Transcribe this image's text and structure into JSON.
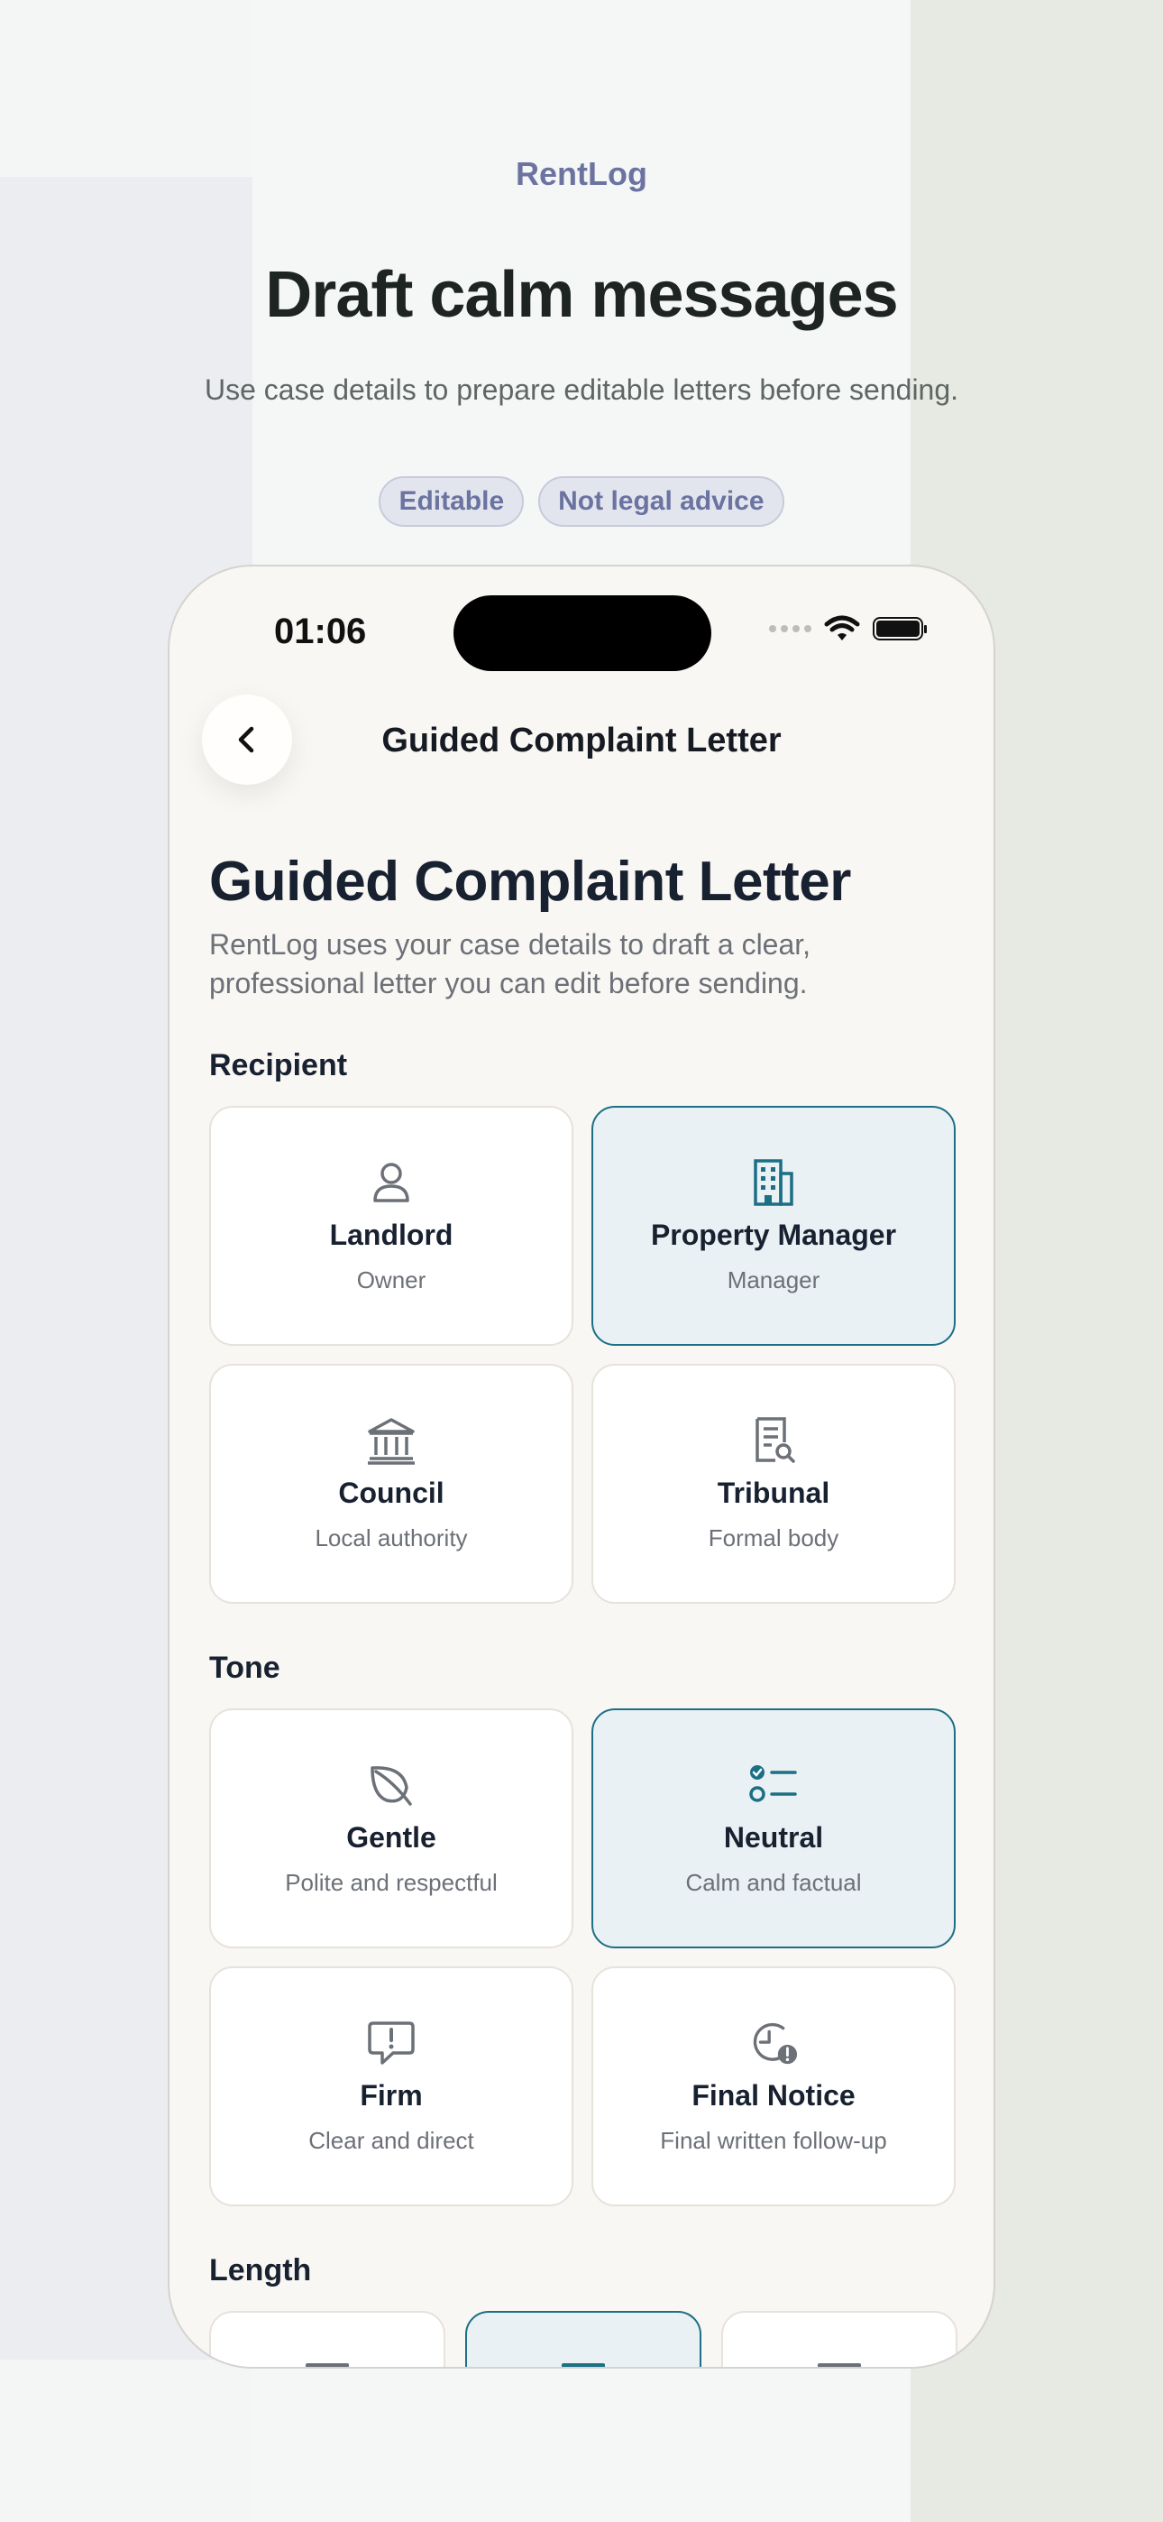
{
  "brand": "RentLog",
  "hero": {
    "title": "Draft calm messages",
    "subtitle": "Use case details to prepare editable letters before sending.",
    "chips": [
      "Editable",
      "Not legal advice"
    ]
  },
  "status_bar": {
    "time": "01:06"
  },
  "nav": {
    "title": "Guided Complaint Letter",
    "back_icon": "chevron-left-icon"
  },
  "page": {
    "title": "Guided Complaint Letter",
    "description": "RentLog uses your case details to draft a clear, professional letter you can edit before sending."
  },
  "recipient": {
    "label": "Recipient",
    "options": [
      {
        "title": "Landlord",
        "subtitle": "Owner",
        "icon": "person-icon",
        "selected": false
      },
      {
        "title": "Property Manager",
        "subtitle": "Manager",
        "icon": "building-icon",
        "selected": true
      },
      {
        "title": "Council",
        "subtitle": "Local authority",
        "icon": "government-building-icon",
        "selected": false
      },
      {
        "title": "Tribunal",
        "subtitle": "Formal body",
        "icon": "document-search-icon",
        "selected": false
      }
    ]
  },
  "tone": {
    "label": "Tone",
    "options": [
      {
        "title": "Gentle",
        "subtitle": "Polite and respectful",
        "icon": "leaf-icon",
        "selected": false
      },
      {
        "title": "Neutral",
        "subtitle": "Calm and factual",
        "icon": "checklist-icon",
        "selected": true
      },
      {
        "title": "Firm",
        "subtitle": "Clear and direct",
        "icon": "exclamation-bubble-icon",
        "selected": false
      },
      {
        "title": "Final Notice",
        "subtitle": "Final written follow-up",
        "icon": "clock-alert-icon",
        "selected": false
      }
    ]
  },
  "length": {
    "label": "Length",
    "options": [
      {
        "icon": "short-lines-icon",
        "selected": false
      },
      {
        "icon": "medium-lines-icon",
        "selected": true
      },
      {
        "icon": "long-lines-icon",
        "selected": false
      }
    ]
  },
  "colors": {
    "accent": "#1c6f85",
    "selected_bg": "#e9f1f4",
    "brand": "#6b73a0",
    "icon_gray": "#6c7077"
  }
}
